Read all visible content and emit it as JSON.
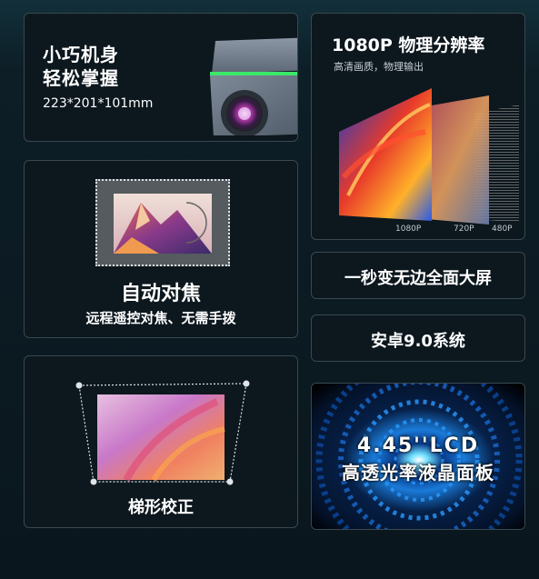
{
  "size_card": {
    "line1": "小巧机身",
    "line2": "轻松掌握",
    "dimensions": "223*201*101mm"
  },
  "resolution_card": {
    "title": "1080P 物理分辨率",
    "subtitle": "高清画质，物理输出",
    "labels": [
      "1080P",
      "720P",
      "480P"
    ]
  },
  "autofocus_card": {
    "title": "自动对焦",
    "subtitle": "远程遥控对焦、无需手拨"
  },
  "fullscreen_card": {
    "text": "一秒变无边全面大屏"
  },
  "android_card": {
    "text": "安卓9.0系统"
  },
  "keystone_card": {
    "title": "梯形校正"
  },
  "lcd_card": {
    "line1": "4.45''LCD",
    "line2": "高透光率液晶面板"
  },
  "colors": {
    "card_border": "#3a4850",
    "card_bg": "#0c171e",
    "accent_green": "#3ce86a"
  },
  "icons": [
    "projector-image",
    "mountain-image",
    "abstract-wave-image",
    "tunnel-image"
  ]
}
